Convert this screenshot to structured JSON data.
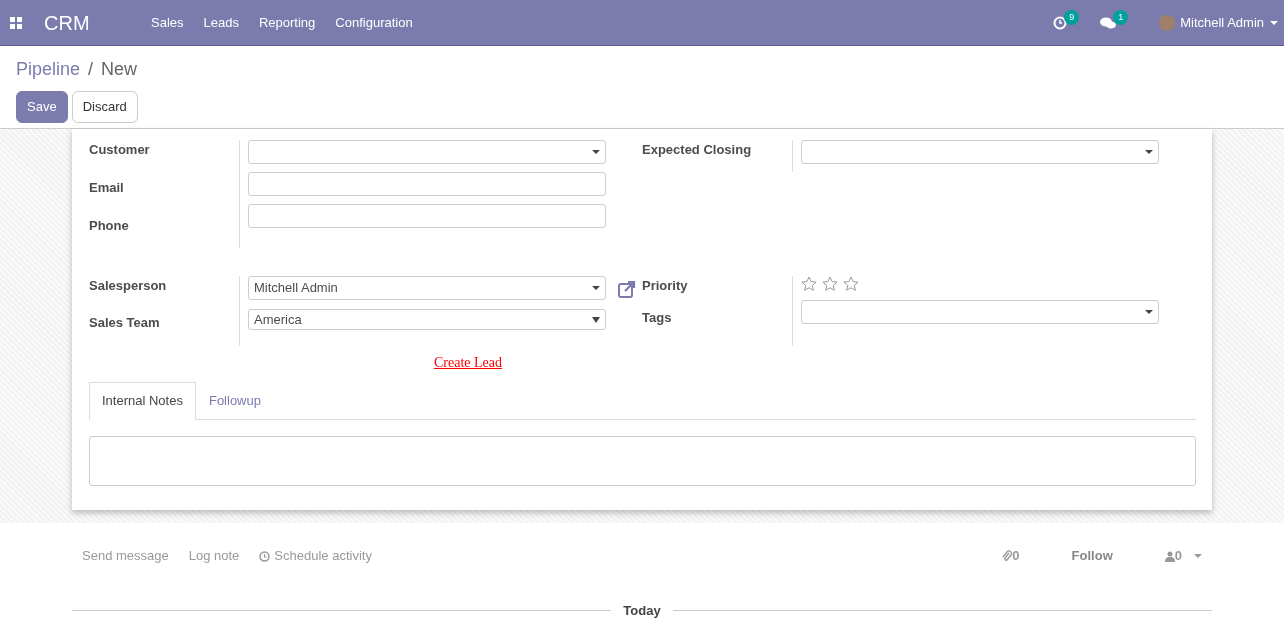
{
  "navbar": {
    "app_title": "CRM",
    "menu": [
      "Sales",
      "Leads",
      "Reporting",
      "Configuration"
    ],
    "activity_count": "9",
    "message_count": "1",
    "user": "Mitchell Admin"
  },
  "breadcrumb": {
    "parent": "Pipeline",
    "separator": "/",
    "current": "New"
  },
  "buttons": [
    {
      "label": "Save",
      "kind": "primary"
    },
    {
      "label": "Discard",
      "kind": "secondary"
    }
  ],
  "form": {
    "contact_fields": [
      {
        "label": "Customer",
        "kind": "select"
      },
      {
        "label": "Email",
        "kind": "text"
      },
      {
        "label": "Phone",
        "kind": "text"
      }
    ],
    "closing_fields": [
      {
        "label": "Expected Closing",
        "kind": "select"
      }
    ],
    "team_fields": [
      {
        "label": "Salesperson",
        "kind": "select",
        "value": "Mitchell Admin"
      },
      {
        "label": "Sales Team",
        "kind": "native",
        "value": "America"
      }
    ],
    "priority": {
      "label": "Priority",
      "stars": 0
    },
    "tags": {
      "label": "Tags"
    },
    "create_lead": "Create Lead",
    "tabs": [
      {
        "label": "Internal Notes",
        "selected": true
      },
      {
        "label": "Followup",
        "selected": false
      }
    ]
  },
  "chatter": {
    "actions": [
      "Send message",
      "Log note",
      "Schedule activity"
    ],
    "attachments": "0",
    "follow": "Follow",
    "followers": "0",
    "date_separator": "Today"
  }
}
